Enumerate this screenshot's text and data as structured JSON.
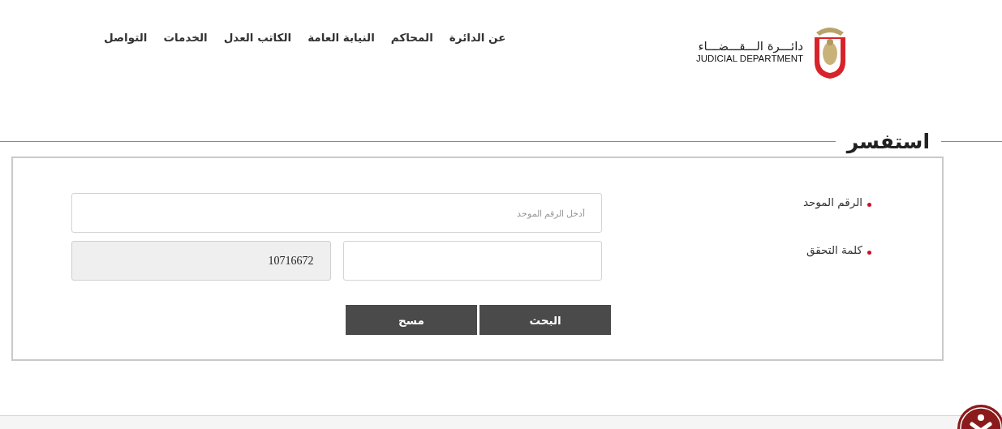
{
  "header": {
    "logo": {
      "arabic": "دائـــرة الـــقـــضـــاء",
      "english": "JUDICIAL DEPARTMENT"
    },
    "nav": [
      "عن الدائرة",
      "المحاكم",
      "النيابة العامة",
      "الكاتب العدل",
      "الخدمات",
      "التواصل"
    ]
  },
  "inquiry": {
    "title": "استفسر",
    "fields": [
      {
        "label": "الرقم الموحد",
        "required": true,
        "placeholder": "أدخل الرقم الموحد"
      },
      {
        "label": "كلمة التحقق",
        "required": true,
        "captcha_code": "10716672"
      }
    ],
    "buttons": [
      "البحث",
      "مسح"
    ]
  }
}
